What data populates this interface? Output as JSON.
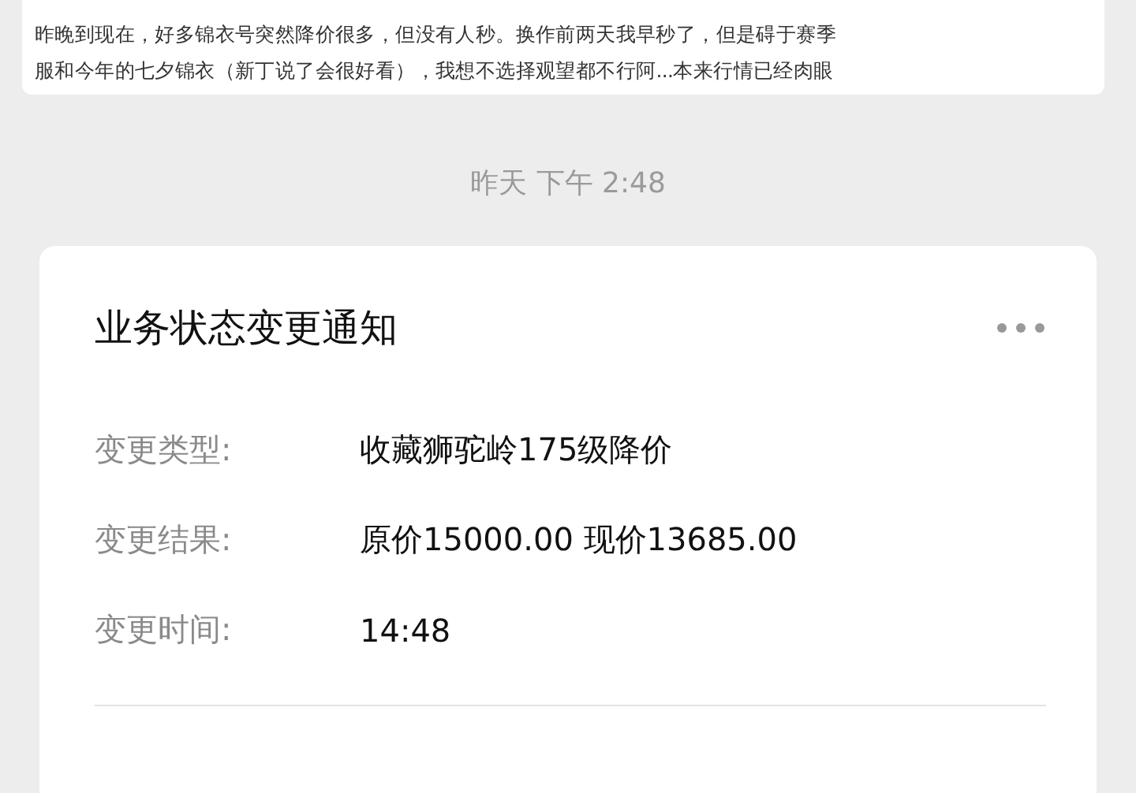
{
  "previous_message": {
    "lines": [
      "昨晚到现在，好多锦衣号突然降价很多，但没有人秒。换作前两天我早秒了，但是碍于赛季",
      "服和今年的七夕锦衣（新丁说了会很好看），我想不选择观望都不行阿...本来行情已经肉眼"
    ]
  },
  "timestamp": "昨天 下午 2:48",
  "card": {
    "title": "业务状态变更通知",
    "fields": [
      {
        "label": "变更类型:",
        "value": "收藏狮驼岭175级降价"
      },
      {
        "label": "变更结果:",
        "value": "原价15000.00 现价13685.00"
      },
      {
        "label": "变更时间:",
        "value": "14:48"
      }
    ]
  }
}
